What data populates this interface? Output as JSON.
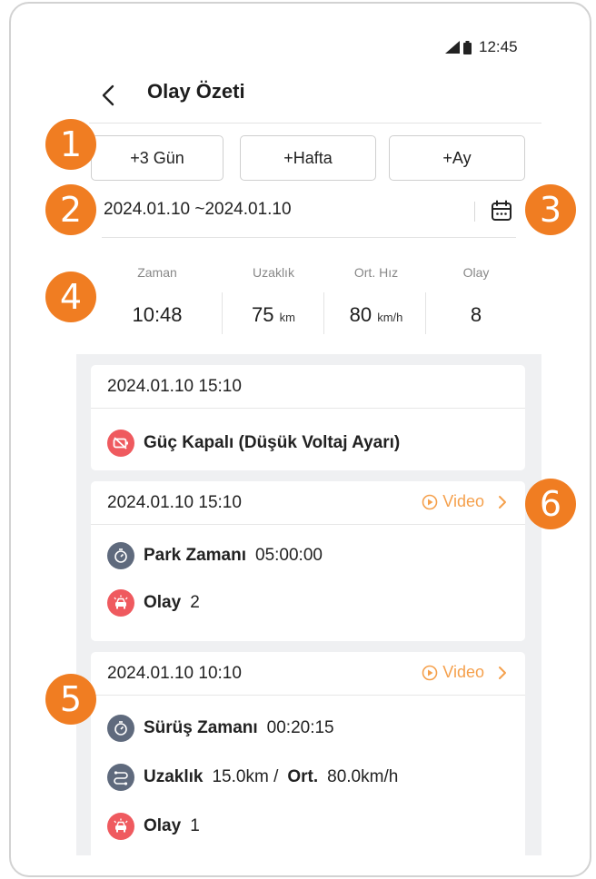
{
  "status": {
    "time": "12:45"
  },
  "header": {
    "title": "Olay Özeti"
  },
  "range_buttons": [
    "+3 Gün",
    "+Hafta",
    "+Ay"
  ],
  "date_range": "2024.01.10 ~2024.01.10",
  "stats": [
    {
      "label": "Zaman",
      "value": "10:48",
      "unit": ""
    },
    {
      "label": "Uzaklık",
      "value": "75",
      "unit": "km"
    },
    {
      "label": "Ort. Hız",
      "value": "80",
      "unit": "km/h"
    },
    {
      "label": "Olay",
      "value": "8",
      "unit": ""
    }
  ],
  "cards": [
    {
      "time": "2024.01.10 15:10",
      "rows": [
        {
          "icon": "power-off-icon",
          "text": "Güç Kapalı (Düşük Voltaj Ayarı)"
        }
      ]
    },
    {
      "time": "2024.01.10 15:10",
      "video_label": "Video",
      "rows": [
        {
          "icon": "timer-icon",
          "label": "Park Zamanı",
          "value": "05:00:00"
        },
        {
          "icon": "car-event-icon",
          "label": "Olay",
          "value": "2"
        }
      ]
    },
    {
      "time": "2024.01.10 10:10",
      "video_label": "Video",
      "rows": [
        {
          "icon": "timer-icon",
          "label": "Sürüş Zamanı",
          "value": "00:20:15"
        },
        {
          "icon": "route-icon",
          "label": "Uzaklık",
          "value": "15.0km /",
          "label2": "Ort.",
          "value2": "80.0km/h"
        },
        {
          "icon": "car-event-icon",
          "label": "Olay",
          "value": "1"
        }
      ]
    }
  ],
  "callouts": [
    "1",
    "2",
    "3",
    "4",
    "5",
    "6"
  ],
  "colors": {
    "accent": "#f07d22",
    "video": "#f5a04c",
    "event_red": "#ef5a5f",
    "icon_gray": "#5f6a7d",
    "list_bg": "#eff0f2"
  }
}
